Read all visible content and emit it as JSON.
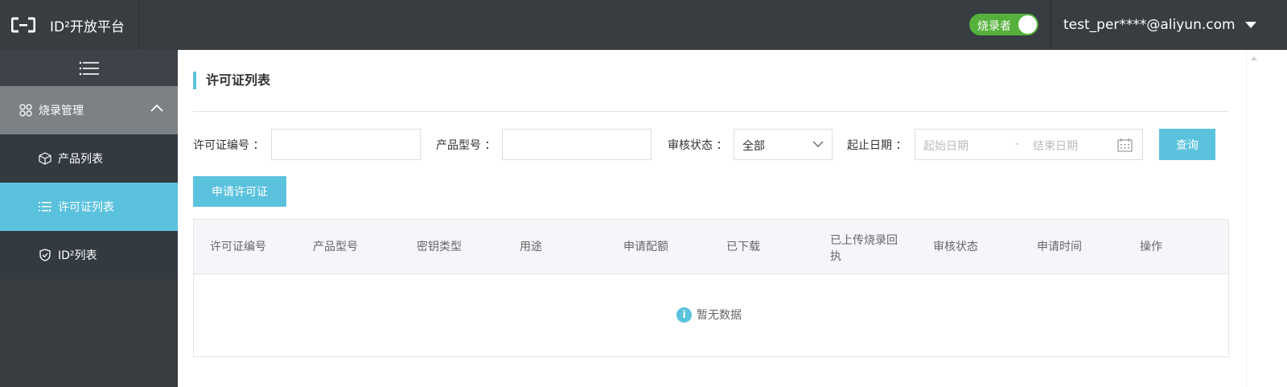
{
  "header": {
    "brand": "ID²开放平台",
    "role_toggle_label": "烧录者",
    "user_email": "test_per****@aliyun.com"
  },
  "sidebar": {
    "group_label": "烧录管理",
    "items": [
      {
        "label": "产品列表"
      },
      {
        "label": "许可证列表"
      },
      {
        "label": "ID²列表"
      }
    ]
  },
  "main": {
    "title": "许可证列表",
    "filters": {
      "license_no_label": "许可证编号 ：",
      "product_model_label": "产品型号 ：",
      "review_status_label": "审核状态 ：",
      "review_status_value": "全部",
      "date_range_label": "起止日期 ：",
      "start_date_placeholder": "起始日期",
      "date_separator": "-",
      "end_date_placeholder": "结束日期",
      "query_button": "查询"
    },
    "apply_button": "申请许可证",
    "table": {
      "columns": [
        "许可证编号",
        "产品型号",
        "密钥类型",
        "用途",
        "申请配额",
        "已下载",
        "已上传烧录回执",
        "审核状态",
        "申请时间",
        "操作"
      ],
      "empty_text": "暂无数据"
    }
  },
  "colors": {
    "topbar": "#373d41",
    "accent": "#5bc2dd",
    "toggle_on": "#55b13c"
  }
}
